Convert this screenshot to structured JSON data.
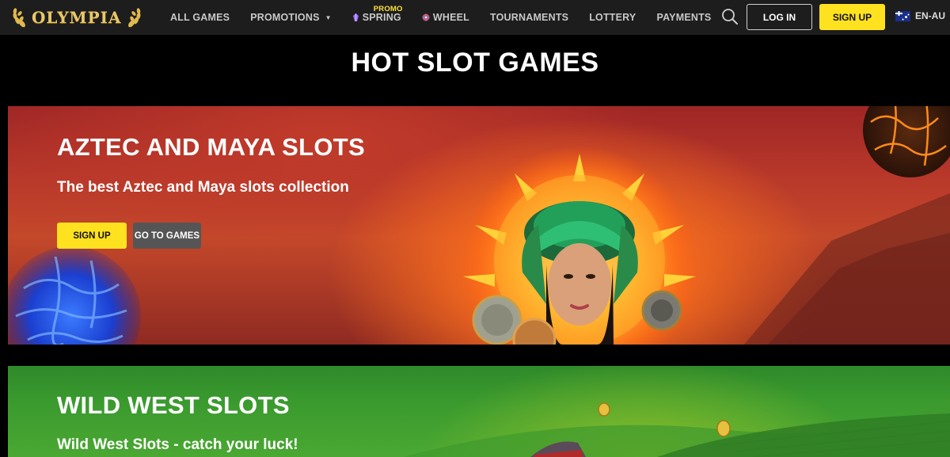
{
  "header": {
    "logo_text": "OLYMPIA",
    "nav": [
      {
        "label": "ALL GAMES"
      },
      {
        "label": "PROMOTIONS",
        "has_caret": true
      },
      {
        "label": "SPRING",
        "badge": "PROMO",
        "icon": "spring-icon"
      },
      {
        "label": "WHEEL",
        "icon": "wheel-icon"
      },
      {
        "label": "TOURNAMENTS"
      },
      {
        "label": "LOTTERY"
      },
      {
        "label": "PAYMENTS"
      }
    ],
    "login_label": "LOG IN",
    "signup_label": "SIGN UP",
    "language": "EN-AU",
    "colors": {
      "accent": "#ffe21f",
      "header_bg": "#1d1d1d"
    }
  },
  "page_title": "HOT SLOT GAMES",
  "banners": [
    {
      "title": "AZTEC AND MAYA SLOTS",
      "subtitle": "The best Aztec and Maya slots collection",
      "signup_label": "SIGN UP",
      "goto_label": "GO TO GAMES"
    },
    {
      "title": "WILD WEST SLOTS",
      "subtitle": "Wild West Slots - catch your luck!"
    }
  ]
}
